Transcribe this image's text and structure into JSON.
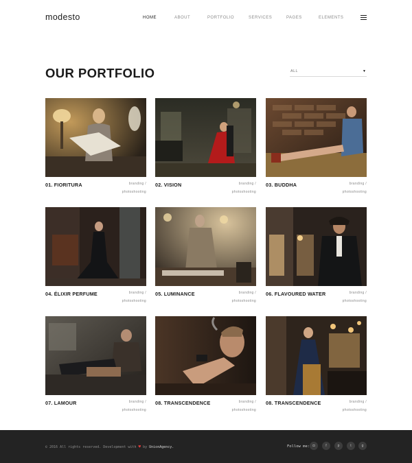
{
  "header": {
    "logo": "modesto",
    "nav": [
      {
        "label": "HOME",
        "active": true
      },
      {
        "label": "ABOUT",
        "active": false
      },
      {
        "label": "PORTFOLIO",
        "active": false
      },
      {
        "label": "SERVICES",
        "active": false
      },
      {
        "label": "PAGES",
        "active": false
      },
      {
        "label": "ELEMENTS",
        "active": false
      }
    ]
  },
  "main": {
    "title": "OUR PORTFOLIO",
    "filter": {
      "value": "ALL"
    }
  },
  "portfolio": [
    {
      "title": "01. FIORITURA",
      "tag1": "branding /",
      "tag2": "photoshooting"
    },
    {
      "title": "02. VISION",
      "tag1": "branding /",
      "tag2": "photoshooting"
    },
    {
      "title": "03. BUDDHA",
      "tag1": "branding /",
      "tag2": "photoshooting"
    },
    {
      "title": "04. ÉLIXIR PERFUME",
      "tag1": "branding /",
      "tag2": "photoshooting"
    },
    {
      "title": "05. LUMINANCE",
      "tag1": "branding /",
      "tag2": "photoshooting"
    },
    {
      "title": "06. FLAVOURED WATER",
      "tag1": "branding /",
      "tag2": "photoshooting"
    },
    {
      "title": "07. LAMOUR",
      "tag1": "branding /",
      "tag2": "photoshooting"
    },
    {
      "title": "08. TRANSCENDENCE",
      "tag1": "branding /",
      "tag2": "photoshooting"
    },
    {
      "title": "08. TRANSCENDENCE",
      "tag1": "branding /",
      "tag2": "photoshooting"
    }
  ],
  "footer": {
    "copyright_before": "© 2016 All rights reserved. Development with",
    "copyright_by": "by",
    "copyright_brand": "UnionAgency.",
    "follow_label": "Follow me:",
    "social": [
      {
        "icon": "instagram-icon",
        "glyph": "◘"
      },
      {
        "icon": "facebook-icon",
        "glyph": "f"
      },
      {
        "icon": "pinterest-icon",
        "glyph": "p"
      },
      {
        "icon": "twitter-icon",
        "glyph": "t"
      },
      {
        "icon": "google-plus-icon",
        "glyph": "g"
      }
    ]
  },
  "colors": {
    "accent": "#1a1a1a",
    "muted": "#8a8a8a",
    "footer_bg": "#232323",
    "heart": "#e23b3b"
  }
}
